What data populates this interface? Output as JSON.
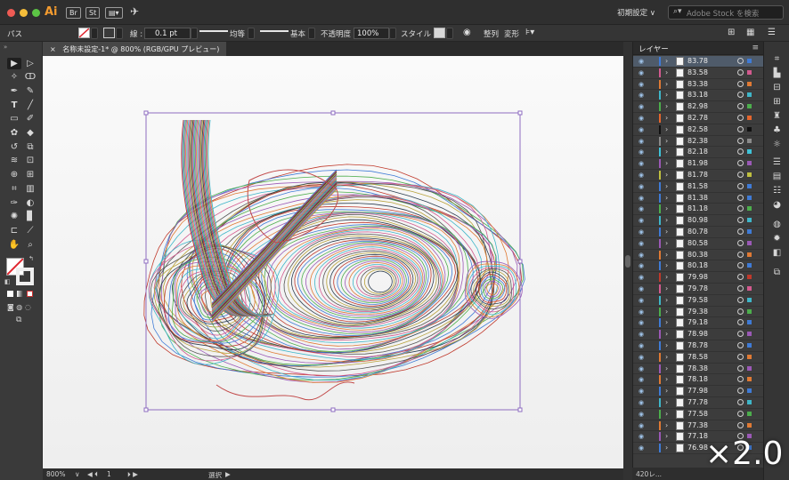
{
  "app": {
    "logo": "Ai",
    "bridge_label": "Br",
    "stock_label": "St",
    "workspace_preset": "初期設定 ∨",
    "stock_search_placeholder": "Adobe Stock を検索"
  },
  "control_bar": {
    "selection_type": "パス",
    "stroke_label": "線 :",
    "stroke_weight": "0.1 pt",
    "profile_label": "均等",
    "brush_label": "基本",
    "opacity_label": "不透明度 :",
    "opacity_value": "100%",
    "style_label": "スタイル :",
    "align_label": "整列",
    "transform_label": "変形"
  },
  "document": {
    "tab_label": "名称未設定-1* @ 800% (RGB/GPU プレビュー)"
  },
  "status_bar": {
    "zoom": "800%",
    "artboard_number": "1",
    "tool_status": "選択"
  },
  "layers_panel": {
    "title": "レイヤー",
    "footer_count": "420レ...",
    "items": [
      {
        "name": "83.78",
        "color": "#3f7bd6",
        "sel": "#3f7bd6"
      },
      {
        "name": "83.58",
        "color": "#d35a8f",
        "sel": "#d35a8f"
      },
      {
        "name": "83.38",
        "color": "#e07a34",
        "sel": "#e07a34"
      },
      {
        "name": "83.18",
        "color": "#3fb6c9",
        "sel": "#3fb6c9"
      },
      {
        "name": "82.98",
        "color": "#4cae4c",
        "sel": "#4cae4c"
      },
      {
        "name": "82.78",
        "color": "#e4652d",
        "sel": "#e4652d"
      },
      {
        "name": "82.58",
        "color": "#111111",
        "sel": "#111111"
      },
      {
        "name": "82.38",
        "color": "#8a8a8a",
        "sel": "#8a8a8a"
      },
      {
        "name": "82.18",
        "color": "#3fc3d8",
        "sel": "#3fc3d8"
      },
      {
        "name": "81.98",
        "color": "#9b59b6",
        "sel": "#9b59b6"
      },
      {
        "name": "81.78",
        "color": "#c0c040",
        "sel": "#c0c040"
      },
      {
        "name": "81.58",
        "color": "#3f7bd6",
        "sel": "#3f7bd6"
      },
      {
        "name": "81.38",
        "color": "#3f7bd6",
        "sel": "#3f7bd6"
      },
      {
        "name": "81.18",
        "color": "#4cae4c",
        "sel": "#4cae4c"
      },
      {
        "name": "80.98",
        "color": "#3fb6c9",
        "sel": "#3fb6c9"
      },
      {
        "name": "80.78",
        "color": "#3f7bd6",
        "sel": "#3f7bd6"
      },
      {
        "name": "80.58",
        "color": "#9b59b6",
        "sel": "#9b59b6"
      },
      {
        "name": "80.38",
        "color": "#e07a34",
        "sel": "#e07a34"
      },
      {
        "name": "80.18",
        "color": "#3f7bd6",
        "sel": "#3f7bd6"
      },
      {
        "name": "79.98",
        "color": "#c0392b",
        "sel": "#c0392b"
      },
      {
        "name": "79.78",
        "color": "#d35a8f",
        "sel": "#d35a8f"
      },
      {
        "name": "79.58",
        "color": "#3fb6c9",
        "sel": "#3fb6c9"
      },
      {
        "name": "79.38",
        "color": "#4cae4c",
        "sel": "#4cae4c"
      },
      {
        "name": "79.18",
        "color": "#3f7bd6",
        "sel": "#3f7bd6"
      },
      {
        "name": "78.98",
        "color": "#9b59b6",
        "sel": "#9b59b6"
      },
      {
        "name": "78.78",
        "color": "#3f7bd6",
        "sel": "#3f7bd6"
      },
      {
        "name": "78.58",
        "color": "#e07a34",
        "sel": "#e07a34"
      },
      {
        "name": "78.38",
        "color": "#9b59b6",
        "sel": "#9b59b6"
      },
      {
        "name": "78.18",
        "color": "#e07a34",
        "sel": "#e07a34"
      },
      {
        "name": "77.98",
        "color": "#3f7bd6",
        "sel": "#3f7bd6"
      },
      {
        "name": "77.78",
        "color": "#3fb6c9",
        "sel": "#3fb6c9"
      },
      {
        "name": "77.58",
        "color": "#4cae4c",
        "sel": "#4cae4c"
      },
      {
        "name": "77.38",
        "color": "#e07a34",
        "sel": "#e07a34"
      },
      {
        "name": "77.18",
        "color": "#9b59b6",
        "sel": "#9b59b6"
      },
      {
        "name": "76.98",
        "color": "#3f7bd6",
        "sel": "#3f7bd6"
      }
    ]
  },
  "overlay": {
    "speed_label": "×2.0"
  },
  "colors": {
    "selection_box": "#8e6cc0",
    "layer_selected_row": "#4f5b6a"
  }
}
